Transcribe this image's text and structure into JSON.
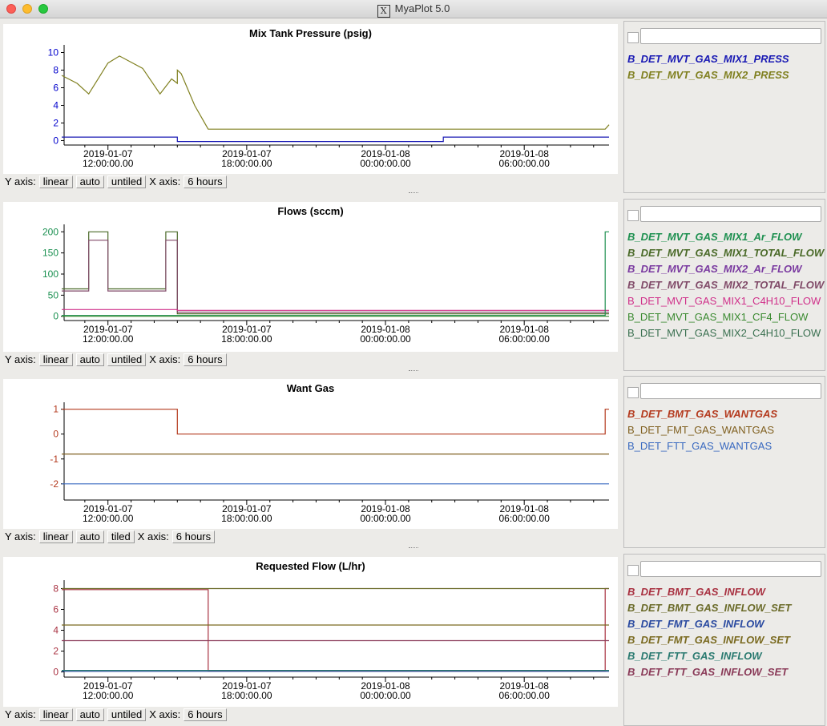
{
  "window": {
    "title": "MyaPlot 5.0"
  },
  "panels": [
    {
      "title": "Mix Tank Pressure (psig)",
      "controls": {
        "y_label": "Y axis:",
        "scale": "linear",
        "range": "auto",
        "tile": "untiled",
        "x_label": "X axis:",
        "span": "6 hours"
      },
      "legend": [
        {
          "name": "B_DET_MVT_GAS_MIX1_PRESS",
          "color": "#1a1ab4",
          "bold": true
        },
        {
          "name": "B_DET_MVT_GAS_MIX2_PRESS",
          "color": "#808020",
          "bold": true
        }
      ]
    },
    {
      "title": "Flows (sccm)",
      "controls": {
        "y_label": "Y axis:",
        "scale": "linear",
        "range": "auto",
        "tile": "untiled",
        "x_label": "X axis:",
        "span": "6 hours"
      },
      "legend": [
        {
          "name": "B_DET_MVT_GAS_MIX1_Ar_FLOW",
          "color": "#1e9050",
          "bold": true
        },
        {
          "name": "B_DET_MVT_GAS_MIX1_TOTAL_FLOW",
          "color": "#4a6a28",
          "bold": true
        },
        {
          "name": "B_DET_MVT_GAS_MIX2_Ar_FLOW",
          "color": "#7a3aa0",
          "bold": true
        },
        {
          "name": "B_DET_MVT_GAS_MIX2_TOTAL_FLOW",
          "color": "#804a68",
          "bold": true
        },
        {
          "name": "B_DET_MVT_GAS_MIX1_C4H10_FLOW",
          "color": "#d0308a",
          "bold": false
        },
        {
          "name": "B_DET_MVT_GAS_MIX1_CF4_FLOW",
          "color": "#3a8a30",
          "bold": false
        },
        {
          "name": "B_DET_MVT_GAS_MIX2_C4H10_FLOW",
          "color": "#3a7050",
          "bold": false
        }
      ]
    },
    {
      "title": "Want Gas",
      "controls": {
        "y_label": "Y axis:",
        "scale": "linear",
        "range": "auto",
        "tile": "tiled",
        "x_label": "X axis:",
        "span": "6 hours"
      },
      "legend": [
        {
          "name": "B_DET_BMT_GAS_WANTGAS",
          "color": "#b43a1e",
          "bold": true
        },
        {
          "name": "B_DET_FMT_GAS_WANTGAS",
          "color": "#806020",
          "bold": false
        },
        {
          "name": "B_DET_FTT_GAS_WANTGAS",
          "color": "#3a6ac0",
          "bold": false
        }
      ]
    },
    {
      "title": "Requested Flow (L/hr)",
      "controls": {
        "y_label": "Y axis:",
        "scale": "linear",
        "range": "auto",
        "tile": "untiled",
        "x_label": "X axis:",
        "span": "6 hours"
      },
      "legend": [
        {
          "name": "B_DET_BMT_GAS_INFLOW",
          "color": "#a83040",
          "bold": true
        },
        {
          "name": "B_DET_BMT_GAS_INFLOW_SET",
          "color": "#6a6a28",
          "bold": true
        },
        {
          "name": "B_DET_FMT_GAS_INFLOW",
          "color": "#2a4aa0",
          "bold": true
        },
        {
          "name": "B_DET_FMT_GAS_INFLOW_SET",
          "color": "#7a6a20",
          "bold": true
        },
        {
          "name": "B_DET_FTT_GAS_INFLOW",
          "color": "#2a7a70",
          "bold": true
        },
        {
          "name": "B_DET_FTT_GAS_INFLOW_SET",
          "color": "#8a3a58",
          "bold": true
        }
      ]
    }
  ],
  "chart_data": [
    {
      "type": "line",
      "title": "Mix Tank Pressure (psig)",
      "x_ticks": [
        "2019-01-07 12:00:00.00",
        "2019-01-07 18:00:00.00",
        "2019-01-08 00:00:00.00",
        "2019-01-08 06:00:00.00"
      ],
      "ylim": [
        -0.5,
        10.5
      ],
      "y_ticks": [
        0,
        2,
        4,
        6,
        8,
        10
      ],
      "y_tick_color": "#0000cc",
      "series": [
        {
          "name": "B_DET_MVT_GAS_MIX1_PRESS",
          "color": "#1a1ab4",
          "x": [
            "2019-01-07 10:00",
            "2019-01-07 15:00",
            "2019-01-07 15:00",
            "2019-01-08 02:30",
            "2019-01-08 02:30",
            "2019-01-08 09:40"
          ],
          "y": [
            0.4,
            0.4,
            -0.1,
            -0.1,
            0.4,
            0.4
          ]
        },
        {
          "name": "B_DET_MVT_GAS_MIX2_PRESS",
          "color": "#808020",
          "x": [
            "2019-01-07 10:00",
            "2019-01-07 10:40",
            "2019-01-07 11:10",
            "2019-01-07 12:00",
            "2019-01-07 12:30",
            "2019-01-07 13:30",
            "2019-01-07 14:15",
            "2019-01-07 14:45",
            "2019-01-07 15:00",
            "2019-01-07 15:00",
            "2019-01-07 15:10",
            "2019-01-07 15:45",
            "2019-01-07 16:20",
            "2019-01-08 09:30",
            "2019-01-08 09:40"
          ],
          "y": [
            7.4,
            6.5,
            5.3,
            8.8,
            9.6,
            8.2,
            5.3,
            7.0,
            6.5,
            8.0,
            7.6,
            4.0,
            1.3,
            1.3,
            1.8
          ]
        }
      ]
    },
    {
      "type": "line",
      "title": "Flows (sccm)",
      "x_ticks": [
        "2019-01-07 12:00:00.00",
        "2019-01-07 18:00:00.00",
        "2019-01-08 00:00:00.00",
        "2019-01-08 06:00:00.00"
      ],
      "ylim": [
        -10,
        210
      ],
      "y_ticks": [
        0,
        50,
        100,
        150,
        200
      ],
      "y_tick_color": "#1a9050",
      "series": [
        {
          "name": "B_DET_MVT_GAS_MIX1_TOTAL_FLOW",
          "color": "#4a6a28",
          "x": [
            "2019-01-07 10:00",
            "2019-01-07 11:10",
            "2019-01-07 11:10",
            "2019-01-07 12:00",
            "2019-01-07 12:00",
            "2019-01-07 14:30",
            "2019-01-07 14:30",
            "2019-01-07 15:00",
            "2019-01-07 15:00",
            "2019-01-08 09:40"
          ],
          "y": [
            65,
            65,
            200,
            200,
            65,
            65,
            200,
            200,
            6,
            6
          ]
        },
        {
          "name": "B_DET_MVT_GAS_MIX2_TOTAL_FLOW",
          "color": "#804a68",
          "x": [
            "2019-01-07 10:00",
            "2019-01-07 11:10",
            "2019-01-07 11:10",
            "2019-01-07 12:00",
            "2019-01-07 12:00",
            "2019-01-07 14:30",
            "2019-01-07 14:30",
            "2019-01-07 15:00",
            "2019-01-07 15:00",
            "2019-01-08 09:40"
          ],
          "y": [
            60,
            60,
            180,
            180,
            60,
            60,
            180,
            180,
            10,
            10
          ]
        },
        {
          "name": "B_DET_MVT_GAS_MIX1_C4H10_FLOW",
          "color": "#d0308a",
          "x": [
            "2019-01-07 10:00",
            "2019-01-07 15:00",
            "2019-01-07 15:00",
            "2019-01-08 09:40"
          ],
          "y": [
            16,
            16,
            14,
            14
          ]
        },
        {
          "name": "B_DET_MVT_GAS_MIX1_Ar_FLOW",
          "color": "#1e9050",
          "x": [
            "2019-01-07 10:00",
            "2019-01-07 15:00",
            "2019-01-08 09:30",
            "2019-01-08 09:30",
            "2019-01-08 09:40"
          ],
          "y": [
            2,
            2,
            2,
            200,
            200
          ]
        },
        {
          "name": "B_DET_MVT_GAS_MIX1_CF4_FLOW",
          "color": "#3a8a30",
          "x": [
            "2019-01-07 10:00",
            "2019-01-08 09:40"
          ],
          "y": [
            0,
            0
          ]
        }
      ]
    },
    {
      "type": "line",
      "title": "Want Gas",
      "x_ticks": [
        "2019-01-07 12:00:00.00",
        "2019-01-07 18:00:00.00",
        "2019-01-08 00:00:00.00",
        "2019-01-08 06:00:00.00"
      ],
      "ylim": [
        -2.65,
        1.15
      ],
      "y_ticks": [
        1,
        0,
        -1,
        -2
      ],
      "y_tick_color": "#b43a1e",
      "series": [
        {
          "name": "B_DET_BMT_GAS_WANTGAS",
          "color": "#b43a1e",
          "x": [
            "2019-01-07 10:00",
            "2019-01-07 15:00",
            "2019-01-07 15:00",
            "2019-01-08 09:30",
            "2019-01-08 09:30",
            "2019-01-08 09:40"
          ],
          "y": [
            1,
            1,
            0,
            0,
            1,
            1
          ]
        },
        {
          "name": "B_DET_FMT_GAS_WANTGAS",
          "color": "#806020",
          "x": [
            "2019-01-07 10:00",
            "2019-01-08 09:40"
          ],
          "y": [
            -0.8,
            -0.8
          ]
        },
        {
          "name": "B_DET_FTT_GAS_WANTGAS",
          "color": "#3a6ac0",
          "x": [
            "2019-01-07 10:00",
            "2019-01-08 09:40"
          ],
          "y": [
            -2,
            -2
          ]
        }
      ]
    },
    {
      "type": "line",
      "title": "Requested Flow (L/hr)",
      "x_ticks": [
        "2019-01-07 12:00:00.00",
        "2019-01-07 18:00:00.00",
        "2019-01-08 00:00:00.00",
        "2019-01-08 06:00:00.00"
      ],
      "ylim": [
        -0.5,
        8.5
      ],
      "y_ticks": [
        0,
        2,
        4,
        6,
        8
      ],
      "y_tick_color": "#a83040",
      "series": [
        {
          "name": "B_DET_BMT_GAS_INFLOW",
          "color": "#a83040",
          "x": [
            "2019-01-07 10:00",
            "2019-01-07 16:20",
            "2019-01-07 16:20",
            "2019-01-08 09:30",
            "2019-01-08 09:30",
            "2019-01-08 09:40"
          ],
          "y": [
            7.9,
            7.9,
            0.1,
            0.1,
            8.0,
            8.0
          ]
        },
        {
          "name": "B_DET_BMT_GAS_INFLOW_SET",
          "color": "#6a6a28",
          "x": [
            "2019-01-07 10:00",
            "2019-01-08 09:40"
          ],
          "y": [
            8.0,
            8.0
          ]
        },
        {
          "name": "B_DET_FMT_GAS_INFLOW_SET",
          "color": "#7a6a20",
          "x": [
            "2019-01-07 10:00",
            "2019-01-08 09:40"
          ],
          "y": [
            4.5,
            4.5
          ]
        },
        {
          "name": "B_DET_FTT_GAS_INFLOW_SET",
          "color": "#8a3a58",
          "x": [
            "2019-01-07 10:00",
            "2019-01-08 09:40"
          ],
          "y": [
            3.0,
            3.0
          ]
        },
        {
          "name": "B_DET_FMT_GAS_INFLOW",
          "color": "#2a4aa0",
          "x": [
            "2019-01-07 10:00",
            "2019-01-08 09:40"
          ],
          "y": [
            0.05,
            0.05
          ]
        },
        {
          "name": "B_DET_FTT_GAS_INFLOW",
          "color": "#2a7a70",
          "x": [
            "2019-01-07 10:00",
            "2019-01-08 09:40"
          ],
          "y": [
            0.15,
            0.15
          ]
        }
      ]
    }
  ]
}
